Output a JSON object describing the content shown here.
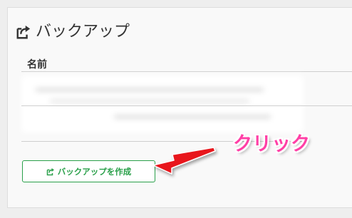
{
  "panel": {
    "title": "バックアップ",
    "title_icon": "share-export-icon"
  },
  "table": {
    "column_header": "名前"
  },
  "create_button": {
    "label": "バックアップを作成",
    "icon": "share-export-icon"
  },
  "annotation": {
    "callout_text": "クリック",
    "callout_color": "#ff3fa6",
    "arrow_color": "#e8151b"
  },
  "colors": {
    "button_green": "#2aa04a",
    "panel_bg": "#f9f9f9",
    "page_bg": "#eeeeee"
  }
}
